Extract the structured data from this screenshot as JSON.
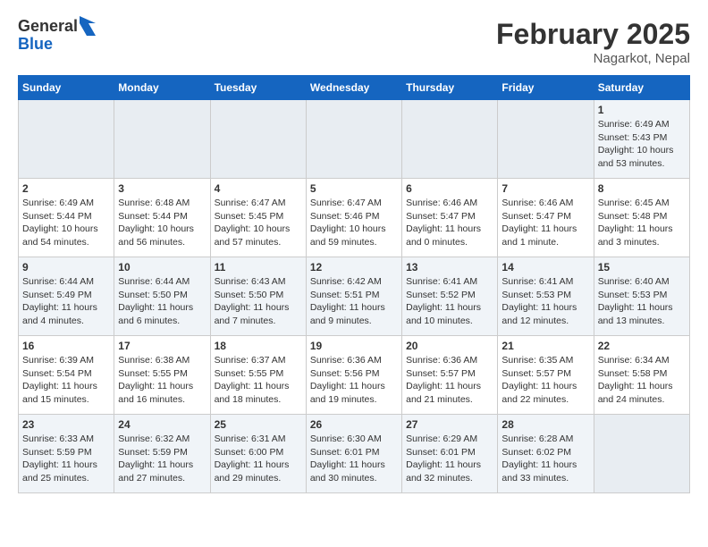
{
  "header": {
    "logo": {
      "general": "General",
      "blue": "Blue"
    },
    "title": "February 2025",
    "location": "Nagarkot, Nepal"
  },
  "weekdays": [
    "Sunday",
    "Monday",
    "Tuesday",
    "Wednesday",
    "Thursday",
    "Friday",
    "Saturday"
  ],
  "weeks": [
    [
      {
        "day": null
      },
      {
        "day": null
      },
      {
        "day": null
      },
      {
        "day": null
      },
      {
        "day": null
      },
      {
        "day": null
      },
      {
        "day": "1",
        "sunrise": "6:49 AM",
        "sunset": "5:43 PM",
        "daylight": "Daylight: 10 hours and 53 minutes."
      }
    ],
    [
      {
        "day": "2",
        "sunrise": "6:49 AM",
        "sunset": "5:44 PM",
        "daylight": "Daylight: 10 hours and 54 minutes."
      },
      {
        "day": "3",
        "sunrise": "6:48 AM",
        "sunset": "5:44 PM",
        "daylight": "Daylight: 10 hours and 56 minutes."
      },
      {
        "day": "4",
        "sunrise": "6:47 AM",
        "sunset": "5:45 PM",
        "daylight": "Daylight: 10 hours and 57 minutes."
      },
      {
        "day": "5",
        "sunrise": "6:47 AM",
        "sunset": "5:46 PM",
        "daylight": "Daylight: 10 hours and 59 minutes."
      },
      {
        "day": "6",
        "sunrise": "6:46 AM",
        "sunset": "5:47 PM",
        "daylight": "Daylight: 11 hours and 0 minutes."
      },
      {
        "day": "7",
        "sunrise": "6:46 AM",
        "sunset": "5:47 PM",
        "daylight": "Daylight: 11 hours and 1 minute."
      },
      {
        "day": "8",
        "sunrise": "6:45 AM",
        "sunset": "5:48 PM",
        "daylight": "Daylight: 11 hours and 3 minutes."
      }
    ],
    [
      {
        "day": "9",
        "sunrise": "6:44 AM",
        "sunset": "5:49 PM",
        "daylight": "Daylight: 11 hours and 4 minutes."
      },
      {
        "day": "10",
        "sunrise": "6:44 AM",
        "sunset": "5:50 PM",
        "daylight": "Daylight: 11 hours and 6 minutes."
      },
      {
        "day": "11",
        "sunrise": "6:43 AM",
        "sunset": "5:50 PM",
        "daylight": "Daylight: 11 hours and 7 minutes."
      },
      {
        "day": "12",
        "sunrise": "6:42 AM",
        "sunset": "5:51 PM",
        "daylight": "Daylight: 11 hours and 9 minutes."
      },
      {
        "day": "13",
        "sunrise": "6:41 AM",
        "sunset": "5:52 PM",
        "daylight": "Daylight: 11 hours and 10 minutes."
      },
      {
        "day": "14",
        "sunrise": "6:41 AM",
        "sunset": "5:53 PM",
        "daylight": "Daylight: 11 hours and 12 minutes."
      },
      {
        "day": "15",
        "sunrise": "6:40 AM",
        "sunset": "5:53 PM",
        "daylight": "Daylight: 11 hours and 13 minutes."
      }
    ],
    [
      {
        "day": "16",
        "sunrise": "6:39 AM",
        "sunset": "5:54 PM",
        "daylight": "Daylight: 11 hours and 15 minutes."
      },
      {
        "day": "17",
        "sunrise": "6:38 AM",
        "sunset": "5:55 PM",
        "daylight": "Daylight: 11 hours and 16 minutes."
      },
      {
        "day": "18",
        "sunrise": "6:37 AM",
        "sunset": "5:55 PM",
        "daylight": "Daylight: 11 hours and 18 minutes."
      },
      {
        "day": "19",
        "sunrise": "6:36 AM",
        "sunset": "5:56 PM",
        "daylight": "Daylight: 11 hours and 19 minutes."
      },
      {
        "day": "20",
        "sunrise": "6:36 AM",
        "sunset": "5:57 PM",
        "daylight": "Daylight: 11 hours and 21 minutes."
      },
      {
        "day": "21",
        "sunrise": "6:35 AM",
        "sunset": "5:57 PM",
        "daylight": "Daylight: 11 hours and 22 minutes."
      },
      {
        "day": "22",
        "sunrise": "6:34 AM",
        "sunset": "5:58 PM",
        "daylight": "Daylight: 11 hours and 24 minutes."
      }
    ],
    [
      {
        "day": "23",
        "sunrise": "6:33 AM",
        "sunset": "5:59 PM",
        "daylight": "Daylight: 11 hours and 25 minutes."
      },
      {
        "day": "24",
        "sunrise": "6:32 AM",
        "sunset": "5:59 PM",
        "daylight": "Daylight: 11 hours and 27 minutes."
      },
      {
        "day": "25",
        "sunrise": "6:31 AM",
        "sunset": "6:00 PM",
        "daylight": "Daylight: 11 hours and 29 minutes."
      },
      {
        "day": "26",
        "sunrise": "6:30 AM",
        "sunset": "6:01 PM",
        "daylight": "Daylight: 11 hours and 30 minutes."
      },
      {
        "day": "27",
        "sunrise": "6:29 AM",
        "sunset": "6:01 PM",
        "daylight": "Daylight: 11 hours and 32 minutes."
      },
      {
        "day": "28",
        "sunrise": "6:28 AM",
        "sunset": "6:02 PM",
        "daylight": "Daylight: 11 hours and 33 minutes."
      },
      {
        "day": null
      }
    ]
  ]
}
